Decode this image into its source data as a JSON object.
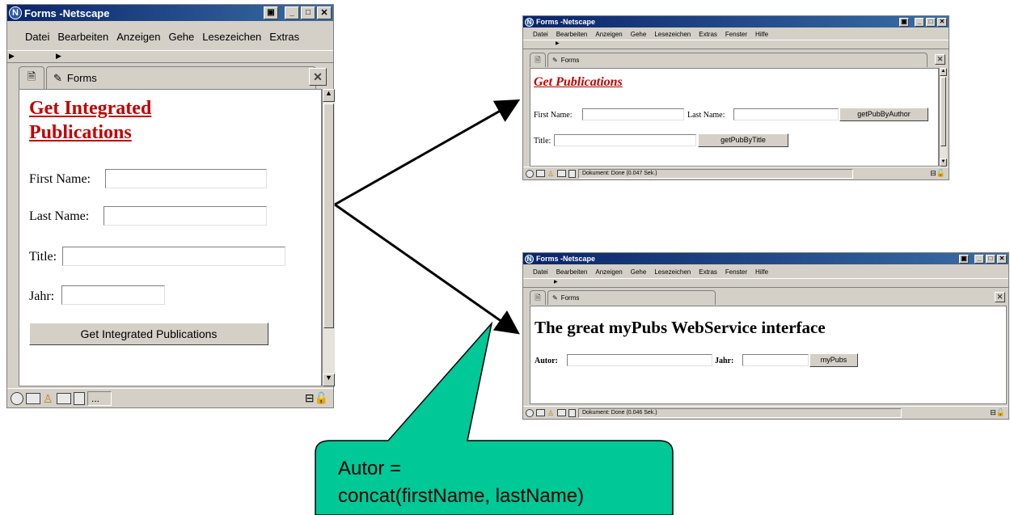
{
  "left_window": {
    "title": "Forms -Netscape",
    "menu": [
      "Datei",
      "Bearbeiten",
      "Anzeigen",
      "Gehe",
      "Lesezeichen",
      "Extras"
    ],
    "tab_label": "Forms",
    "heading": "Get Integrated Publications",
    "fields": [
      {
        "label": "First Name:",
        "value": ""
      },
      {
        "label": "Last Name:",
        "value": ""
      },
      {
        "label": "Title:",
        "value": ""
      },
      {
        "label": "Jahr:",
        "value": ""
      }
    ],
    "submit_label": "Get Integrated Publications",
    "status_text": "..."
  },
  "top_right_window": {
    "title": "Forms -Netscape",
    "menu": [
      "Datei",
      "Bearbeiten",
      "Anzeigen",
      "Gehe",
      "Lesezeichen",
      "Extras",
      "Fenster",
      "Hilfe"
    ],
    "tab_label": "Forms",
    "heading": "Get Publications",
    "first_name_label": "First Name:",
    "last_name_label": "Last Name:",
    "author_button": "getPubByAuthor",
    "title_label": "Title:",
    "title_button": "getPubByTitle",
    "status_text": "Dokument: Done (0.047 Sek.)"
  },
  "bottom_right_window": {
    "title": "Forms -Netscape",
    "menu": [
      "Datei",
      "Bearbeiten",
      "Anzeigen",
      "Gehe",
      "Lesezeichen",
      "Extras",
      "Fenster",
      "Hilfe"
    ],
    "tab_label": "Forms",
    "heading": "The great myPubs WebService interface",
    "autor_label": "Autor:",
    "jahr_label": "Jahr:",
    "submit_label": "myPubs",
    "status_text": "Dokument: Done (0.046 Sek.)"
  },
  "callout": {
    "line1": "Autor =",
    "line2": "concat(firstName, lastName)",
    "color": "#00c896"
  }
}
